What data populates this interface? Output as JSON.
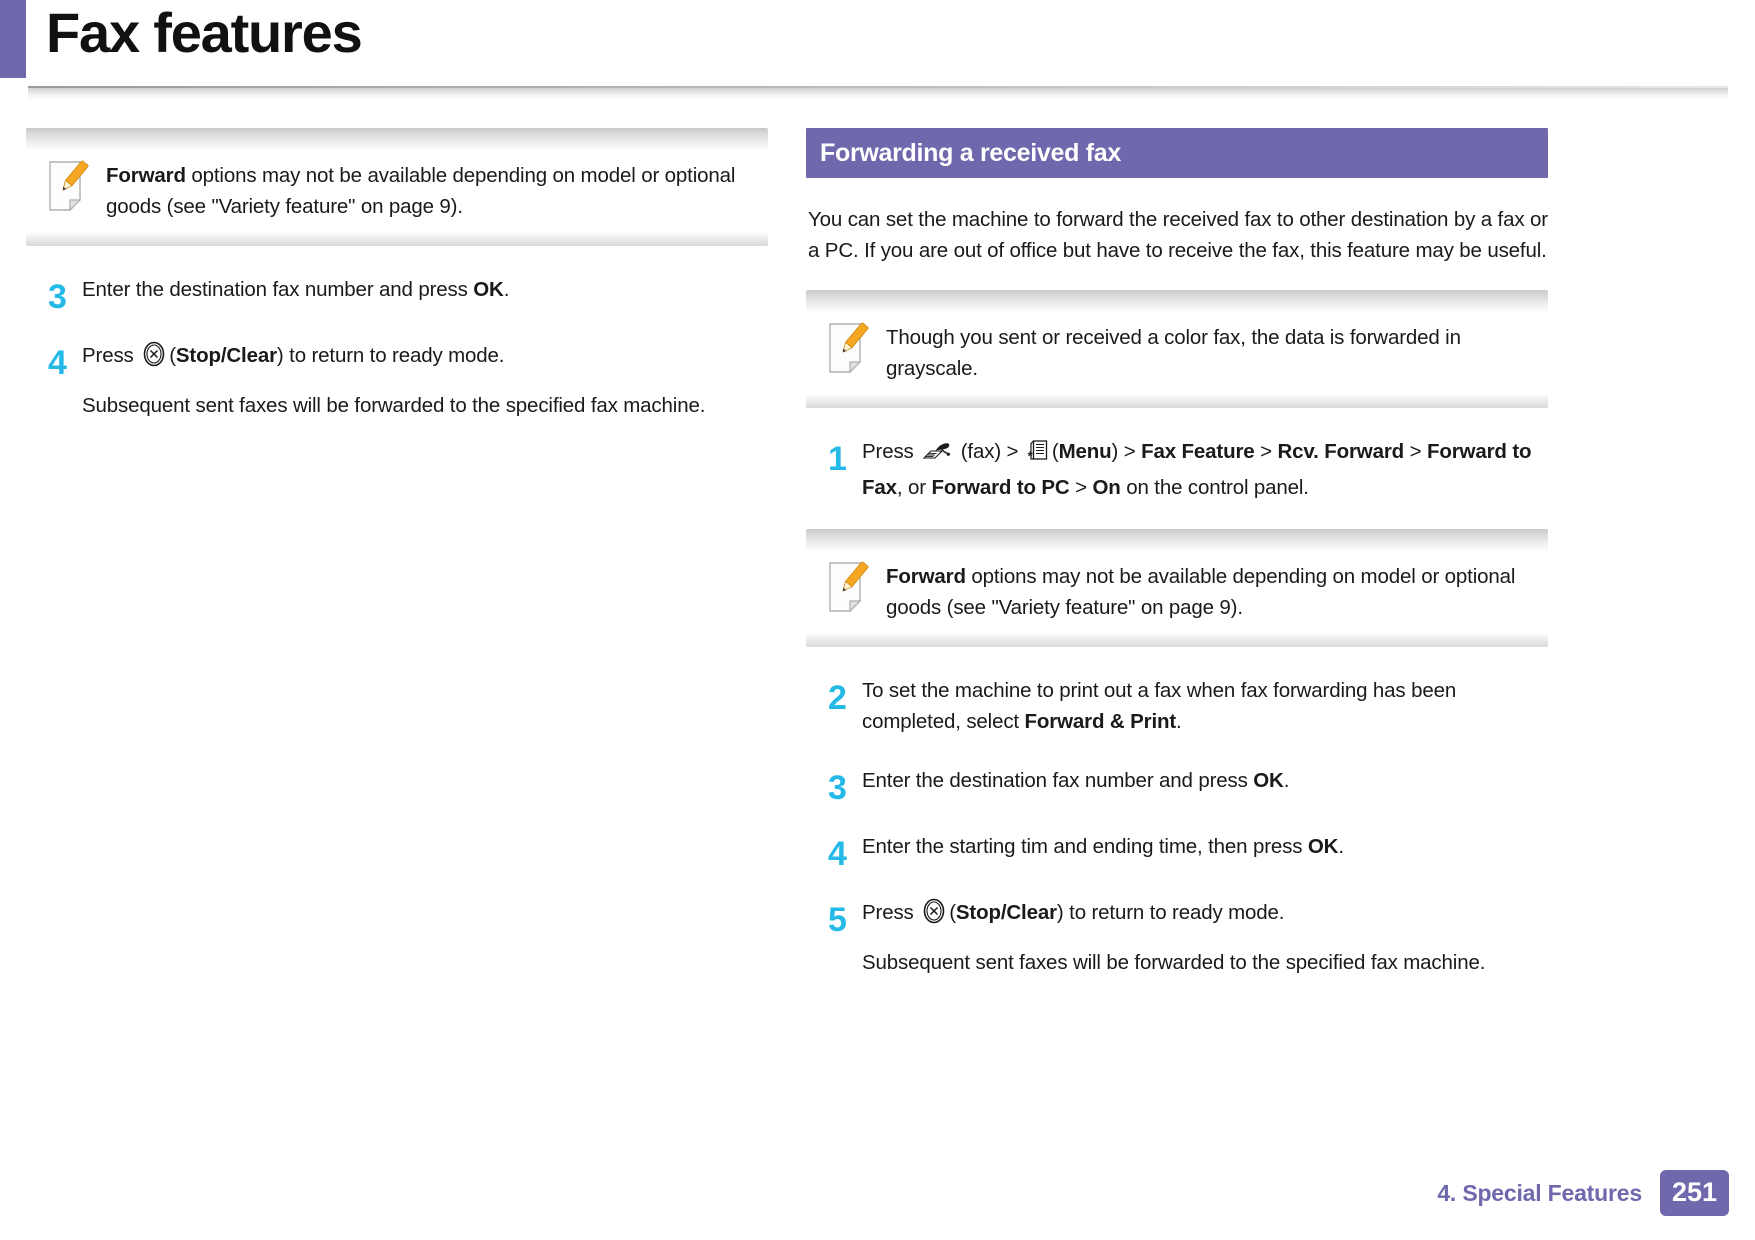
{
  "header": {
    "title": "Fax features",
    "accent_color": "#6f68ad"
  },
  "colors": {
    "accent_purple": "#6f68ad",
    "step_number_cyan": "#25b9e8",
    "note_icon_pencil": "#f5a623",
    "body_text": "#1a1a1a"
  },
  "left_column": {
    "note": {
      "icon": "note-pencil-icon",
      "text_bold_lead": "Forward",
      "text_rest": " options may not be available depending on model or optional goods (see \"Variety feature\" on page 9)."
    },
    "steps": [
      {
        "number": "3",
        "text_before": "Enter the destination fax number and press ",
        "bold": "OK",
        "text_after": "."
      },
      {
        "number": "4",
        "text_before": "Press ",
        "icon": "stop-clear-icon",
        "paren_open": "(",
        "bold": "Stop/Clear",
        "text_after": ") to return to ready mode.",
        "subtext": "Subsequent sent faxes will be forwarded to the specified fax machine."
      }
    ]
  },
  "right_column": {
    "section_heading": "Forwarding a received fax",
    "intro_paragraph": "You can set the machine to forward the received fax to other destination by a fax or a PC. If you are out of office but have to receive the fax, this feature may be useful.",
    "note_grayscale": {
      "icon": "note-pencil-icon",
      "text": "Though you sent or received a color fax, the data is forwarded in grayscale."
    },
    "step_one": {
      "number": "1",
      "seg_press": "Press ",
      "icon_fax": "fax-icon",
      "seg_fax_label": " (fax) > ",
      "icon_menu": "menu-icon",
      "seg_menu_paren_open": "(",
      "bold_menu": "Menu",
      "seg_after_menu": ") > ",
      "bold_fax_feature": "Fax Feature",
      "seg_gt1": " > ",
      "bold_rcv_forward": "Rcv. Forward",
      "seg_gt2": " > ",
      "bold_forward_to_fax": "Forward to Fax",
      "seg_or": ", or ",
      "bold_forward_to_pc": "Forward to PC",
      "seg_gt3": " > ",
      "bold_on": "On",
      "seg_tail": " on the control panel."
    },
    "note_forward": {
      "icon": "note-pencil-icon",
      "text_bold_lead": "Forward",
      "text_rest": " options may not be available depending on model or optional goods (see \"Variety feature\" on page 9)."
    },
    "steps": [
      {
        "number": "2",
        "text_before": "To set the machine to print out a fax when fax forwarding has been completed, select ",
        "bold": "Forward & Print",
        "text_after": "."
      },
      {
        "number": "3",
        "text_before": "Enter the destination fax number and press ",
        "bold": "OK",
        "text_after": "."
      },
      {
        "number": "4",
        "text_before": "Enter the starting tim and ending time, then press ",
        "bold": "OK",
        "text_after": "."
      },
      {
        "number": "5",
        "text_before": "Press ",
        "icon": "stop-clear-icon",
        "paren_open": "(",
        "bold": "Stop/Clear",
        "text_after": ") to return to ready mode.",
        "subtext": "Subsequent sent faxes will be forwarded to the specified fax machine."
      }
    ]
  },
  "footer": {
    "chapter_label": "4.  Special Features",
    "page_number": "251"
  }
}
